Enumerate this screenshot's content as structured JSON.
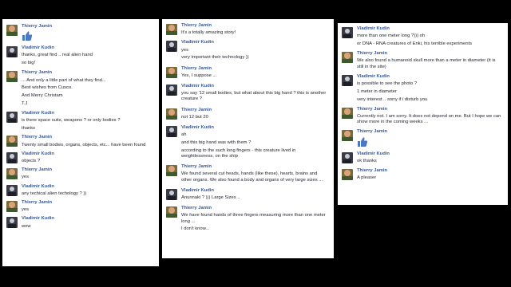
{
  "panels": [
    {
      "messages": [
        {
          "author": "Thierry Jamin",
          "avatar": "thierry",
          "like": true,
          "lines": []
        },
        {
          "author": "Vladimir Kudin",
          "avatar": "vladimir",
          "lines": [
            "thanks, great find .. real alien hand",
            "so big!"
          ]
        },
        {
          "author": "Thierry Jamin",
          "avatar": "thierry",
          "lines": [
            "... And only a little part of what they find...",
            "Best wishes  from Cusco.",
            "And Merry Christam",
            "T.J"
          ]
        },
        {
          "author": "Vladimir Kudin",
          "avatar": "vladimir",
          "lines": [
            "is there space suits, weapons ? or only bodies ?",
            "thanks"
          ]
        },
        {
          "author": "Thierry Jamin",
          "avatar": "thierry",
          "lines": [
            "Twenty small bodies, organs, objects, etc... have been found"
          ]
        },
        {
          "author": "Vladimir Kudin",
          "avatar": "vladimir",
          "lines": [
            "objects ?"
          ]
        },
        {
          "author": "Thierry Jamin",
          "avatar": "thierry",
          "lines": [
            "yes"
          ]
        },
        {
          "author": "Vladimir Kudin",
          "avatar": "vladimir",
          "lines": [
            "any techical alien techology ? ))"
          ]
        },
        {
          "author": "Thierry Jamin",
          "avatar": "thierry",
          "lines": [
            "yes"
          ]
        },
        {
          "author": "Vladimir Kudin",
          "avatar": "vladimir",
          "lines": [
            "wow"
          ]
        }
      ]
    },
    {
      "messages": [
        {
          "author": "Thierry Jamin",
          "avatar": "thierry",
          "lines": [
            "It's a totally amazing story!"
          ]
        },
        {
          "author": "Vladimir Kudin",
          "avatar": "vladimir",
          "lines": [
            "yes",
            "very important their technology ))"
          ]
        },
        {
          "author": "Thierry Jamin",
          "avatar": "thierry",
          "lines": [
            "Yes, I suppose ..."
          ]
        },
        {
          "author": "Vladimir Kudin",
          "avatar": "vladimir",
          "lines": [
            "you say '12 small bodies, but what about this big hand ? this is another creature ?"
          ]
        },
        {
          "author": "Thierry Jamin",
          "avatar": "thierry",
          "lines": [
            "not 12 but 20"
          ]
        },
        {
          "author": "Vladimir Kudin",
          "avatar": "vladimir",
          "lines": [
            "ah",
            "and this big hand was with them ?",
            "according to the such long fingers - this creature lived in weightlessness, on the ship"
          ]
        },
        {
          "author": "Thierry Jamin",
          "avatar": "thierry",
          "lines": [
            "We found several cut heads, hands (like these), hearts, brains and other organs. We also found a body and organs of very large sizes ..."
          ]
        },
        {
          "author": "Vladimir Kudin",
          "avatar": "vladimir",
          "lines": [
            "Anunnaki ? ))) Large Sizes .."
          ]
        },
        {
          "author": "Thierry Jamin",
          "avatar": "thierry",
          "lines": [
            "We have found hands of three fingers measuring more than one meter long ...",
            "I don't know..."
          ]
        }
      ]
    },
    {
      "messages": [
        {
          "author": "Vladimir Kudin",
          "avatar": "vladimir",
          "lines": [
            "more than one meter long ?))) oh",
            "or DNA - RNA  creatures of Enki, his terrible experiments"
          ]
        },
        {
          "author": "Thierry Jamin",
          "avatar": "thierry",
          "lines": [
            "We also found a humanoid skull more than a meter in diameter (it is still in the site)"
          ]
        },
        {
          "author": "Vladimir Kudin",
          "avatar": "vladimir",
          "lines": [
            "is possible to see the photo ?",
            "1 meter in diameter",
            "very interest .. sorry if i disturb you"
          ]
        },
        {
          "author": "Thierry Jamin",
          "avatar": "thierry",
          "lines": [
            "Currently not. I am sorry. It does not depend on me. But I hope we can show more in the coming weeks ..."
          ]
        },
        {
          "author": "Thierry Jamin",
          "avatar": "thierry",
          "like": true,
          "lines": []
        },
        {
          "author": "Vladimir Kudin",
          "avatar": "vladimir",
          "lines": [
            "ok thanks"
          ]
        },
        {
          "author": "Thierry Jamin",
          "avatar": "thierry",
          "lines": [
            "A pleaser"
          ]
        }
      ]
    }
  ],
  "colors": {
    "background": "#000000",
    "name": "#365899",
    "text": "#1d2129",
    "like_icon": "#4a78c2"
  },
  "icons": {
    "avatar": "profile-photo",
    "like": "thumbs-up-icon"
  }
}
